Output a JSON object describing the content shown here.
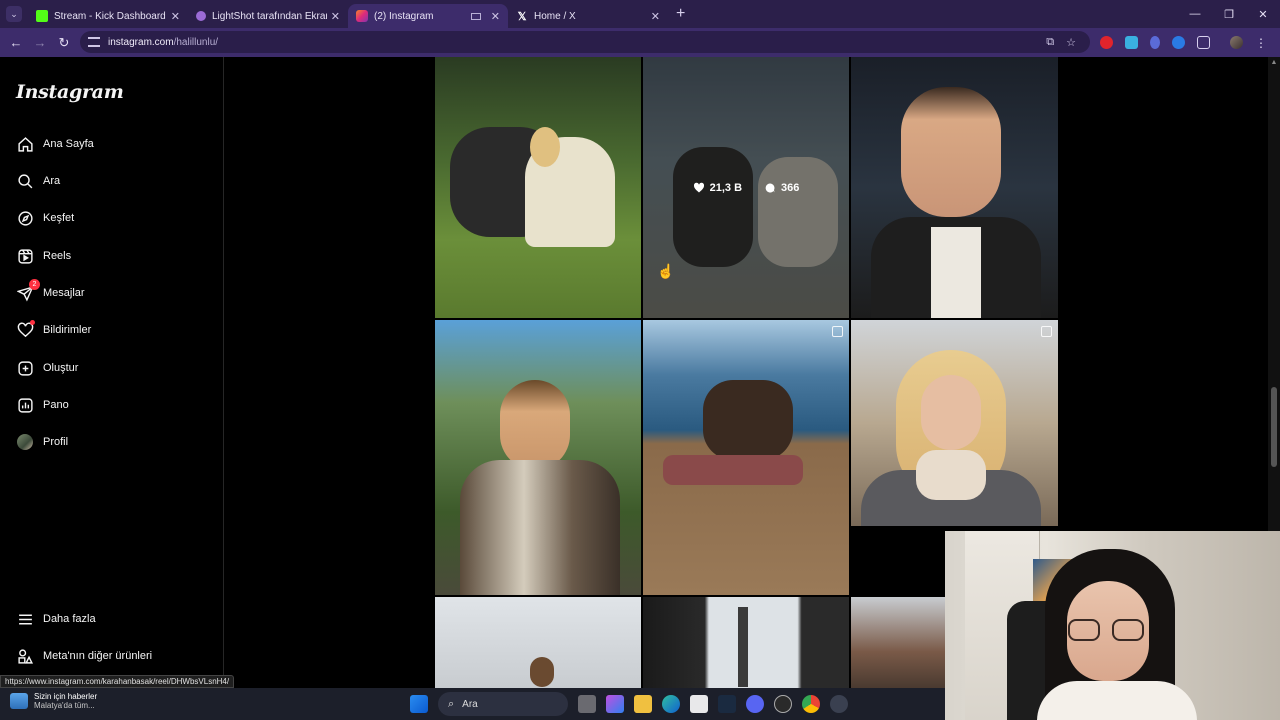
{
  "browser": {
    "tabs": [
      {
        "title": "Stream - Kick Dashboard",
        "favicon_color": "#53fc18",
        "active": false
      },
      {
        "title": "LightShot tarafından Ekran Gör",
        "favicon_color": "#9b6bd6",
        "active": false
      },
      {
        "title": "(2) Instagram",
        "favicon_color": "#e1306c",
        "active": true
      },
      {
        "title": "Home / X",
        "favicon_color": "#ffffff",
        "active": false
      }
    ],
    "url_host": "instagram.com",
    "url_path": "/halillunlu/",
    "status_url": "https://www.instagram.com/karahanbasak/reel/DHWbsVLsnH4/"
  },
  "instagram": {
    "logo": "Instagram",
    "nav": [
      {
        "label": "Ana Sayfa",
        "icon": "home-icon"
      },
      {
        "label": "Ara",
        "icon": "search-icon"
      },
      {
        "label": "Keşfet",
        "icon": "explore-icon"
      },
      {
        "label": "Reels",
        "icon": "reels-icon"
      },
      {
        "label": "Mesajlar",
        "icon": "messages-icon",
        "badge": "2"
      },
      {
        "label": "Bildirimler",
        "icon": "heart-icon"
      },
      {
        "label": "Oluştur",
        "icon": "create-icon"
      },
      {
        "label": "Pano",
        "icon": "dashboard-icon"
      },
      {
        "label": "Profil",
        "icon": "avatar"
      }
    ],
    "more": "Daha fazla",
    "meta_products": "Meta'nın diğer ürünleri",
    "hover_post": {
      "likes": "21,3 B",
      "comments": "366"
    }
  },
  "taskbar": {
    "news_title": "Sizin için haberler",
    "news_sub": "Malatya'da tüm...",
    "search_placeholder": "Ara"
  }
}
